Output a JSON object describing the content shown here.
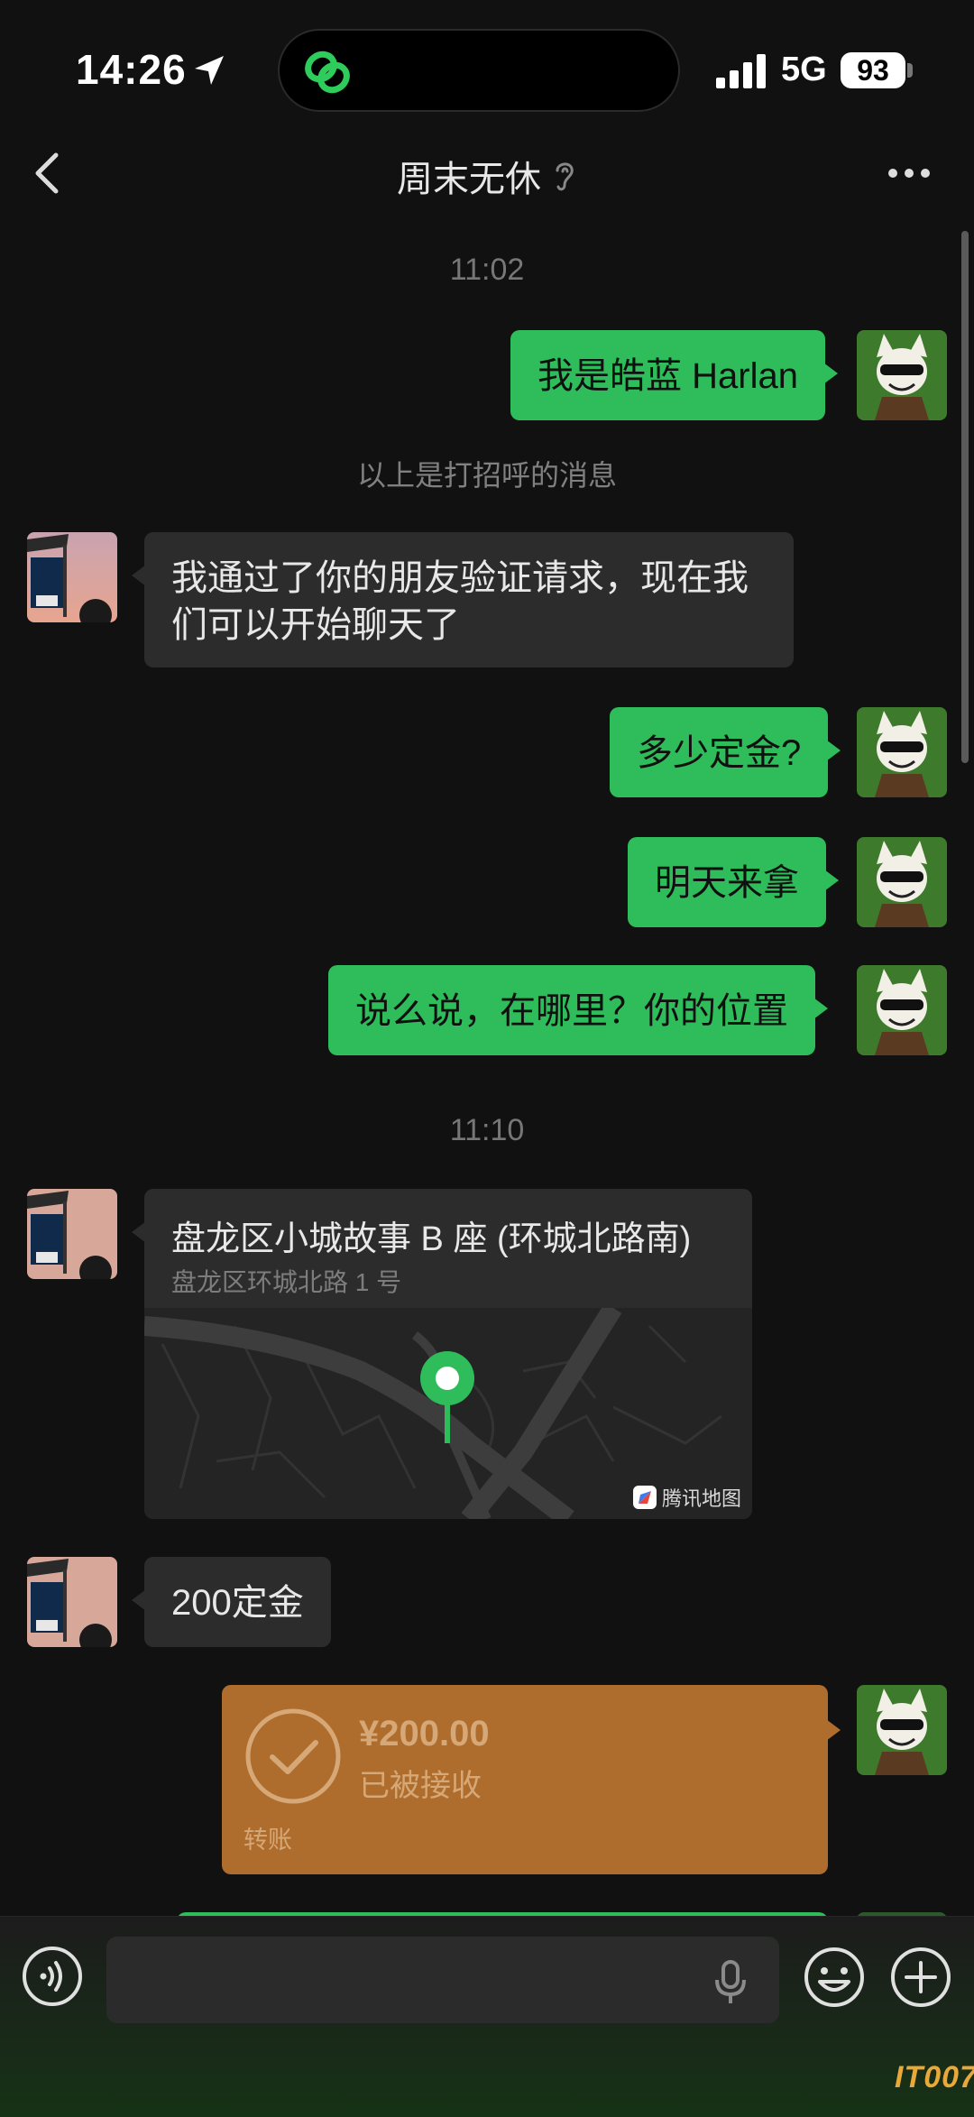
{
  "status_bar": {
    "time": "14:26",
    "network": "5G",
    "battery": "93"
  },
  "header": {
    "title": "周末无休"
  },
  "messages": [
    {
      "kind": "timestamp",
      "text": "11:02"
    },
    {
      "kind": "text",
      "side": "me",
      "text": "我是皓蓝 Harlan"
    },
    {
      "kind": "system",
      "text": "以上是打招呼的消息"
    },
    {
      "kind": "text",
      "side": "them",
      "line1": "我通过了你的朋友验证请求，现在我",
      "line2": "们可以开始聊天了"
    },
    {
      "kind": "text",
      "side": "me",
      "text": "多少定金?"
    },
    {
      "kind": "text",
      "side": "me",
      "text": "明天来拿"
    },
    {
      "kind": "text",
      "side": "me",
      "text": "说么说，在哪里？你的位置"
    },
    {
      "kind": "timestamp",
      "text": "11:10"
    },
    {
      "kind": "location",
      "side": "them",
      "title": "盘龙区小城故事 B 座 (环城北路南)",
      "address": "盘龙区环城北路 1 号",
      "map_provider": "腾讯地图"
    },
    {
      "kind": "text",
      "side": "them",
      "text": "200定金"
    },
    {
      "kind": "transfer",
      "side": "me",
      "amount": "¥200.00",
      "status": "已被接收",
      "label": "转账"
    }
  ],
  "input": {
    "placeholder": ""
  },
  "watermark": "IT007",
  "colors": {
    "my_bubble": "#2ebd5a",
    "their_bubble": "#2c2c2c",
    "transfer": "#ae6d2d",
    "background": "#111111"
  }
}
